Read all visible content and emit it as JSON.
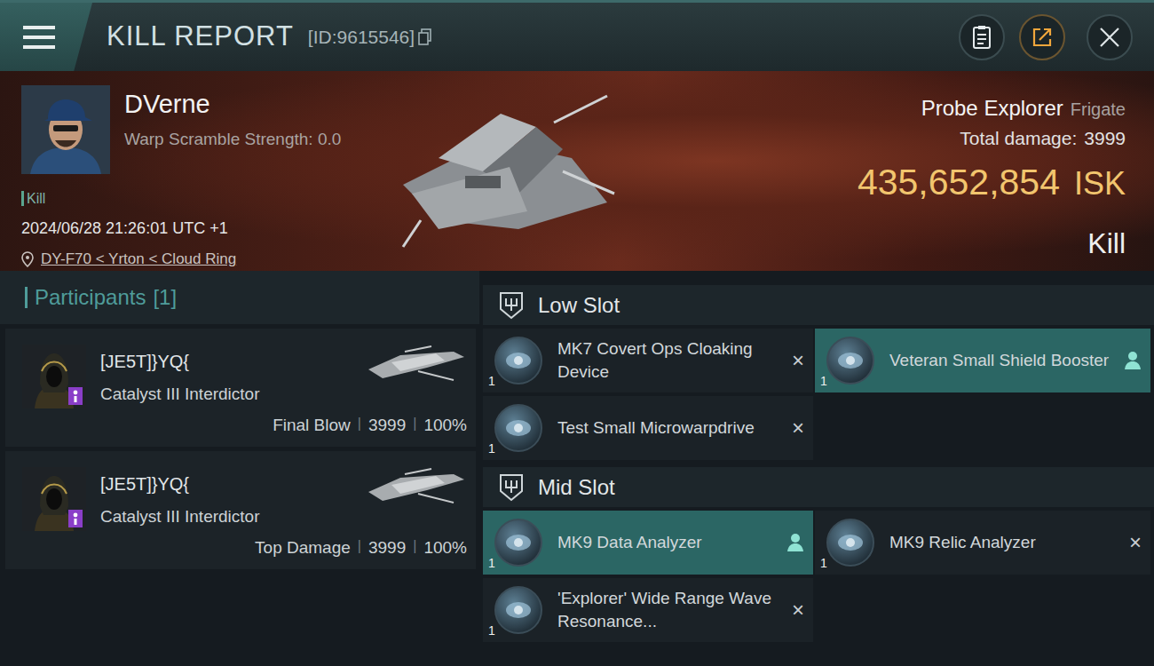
{
  "header": {
    "title": "KILL REPORT",
    "id": "[ID:9615546]"
  },
  "victim": {
    "name": "DVerne",
    "scramble": "Warp Scramble Strength: 0.0",
    "tag": "Kill",
    "time": "2024/06/28 21:26:01 UTC +1",
    "location": "DY-F70 < Yrton < Cloud Ring",
    "ship": "Probe Explorer",
    "ship_class": "Frigate",
    "damage_label": "Total damage:",
    "damage": "3999",
    "value": "435,652,854",
    "currency": "ISK",
    "result": "Kill"
  },
  "separator": "|",
  "participants": {
    "title": "Participants",
    "count": "[1]",
    "items": [
      {
        "name": "[JE5T]}YQ{",
        "ship": "Catalyst III Interdictor",
        "role": "Final Blow",
        "damage": "3999",
        "share": "100%"
      },
      {
        "name": "[JE5T]}YQ{",
        "ship": "Catalyst III Interdictor",
        "role": "Top Damage",
        "damage": "3999",
        "share": "100%"
      }
    ]
  },
  "slots": [
    {
      "title": "Low Slot",
      "items": [
        {
          "name": "MK7 Covert Ops Cloaking Device",
          "quantity": "1",
          "dropped": false,
          "status_glyph": "×"
        },
        {
          "name": "Veteran Small Shield Booster",
          "quantity": "1",
          "dropped": true
        },
        {
          "name": "Test Small Microwarpdrive",
          "quantity": "1",
          "dropped": false,
          "status_glyph": "×"
        }
      ]
    },
    {
      "title": "Mid Slot",
      "items": [
        {
          "name": "MK9 Data Analyzer",
          "quantity": "1",
          "dropped": true
        },
        {
          "name": "MK9 Relic Analyzer",
          "quantity": "1",
          "dropped": false,
          "status_glyph": "×"
        },
        {
          "name": "'Explorer' Wide Range Wave Resonance...",
          "quantity": "1",
          "dropped": false,
          "status_glyph": "×"
        }
      ]
    }
  ]
}
